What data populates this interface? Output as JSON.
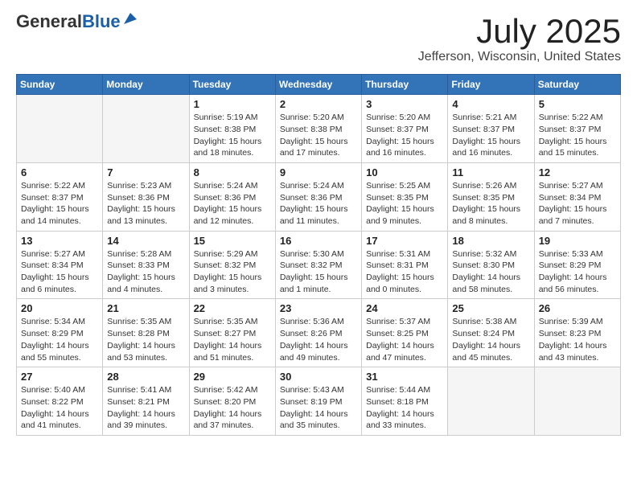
{
  "header": {
    "logo_general": "General",
    "logo_blue": "Blue",
    "title": "July 2025",
    "subtitle": "Jefferson, Wisconsin, United States"
  },
  "weekdays": [
    "Sunday",
    "Monday",
    "Tuesday",
    "Wednesday",
    "Thursday",
    "Friday",
    "Saturday"
  ],
  "weeks": [
    [
      {
        "day": "",
        "info": ""
      },
      {
        "day": "",
        "info": ""
      },
      {
        "day": "1",
        "info": "Sunrise: 5:19 AM\nSunset: 8:38 PM\nDaylight: 15 hours and 18 minutes."
      },
      {
        "day": "2",
        "info": "Sunrise: 5:20 AM\nSunset: 8:38 PM\nDaylight: 15 hours and 17 minutes."
      },
      {
        "day": "3",
        "info": "Sunrise: 5:20 AM\nSunset: 8:37 PM\nDaylight: 15 hours and 16 minutes."
      },
      {
        "day": "4",
        "info": "Sunrise: 5:21 AM\nSunset: 8:37 PM\nDaylight: 15 hours and 16 minutes."
      },
      {
        "day": "5",
        "info": "Sunrise: 5:22 AM\nSunset: 8:37 PM\nDaylight: 15 hours and 15 minutes."
      }
    ],
    [
      {
        "day": "6",
        "info": "Sunrise: 5:22 AM\nSunset: 8:37 PM\nDaylight: 15 hours and 14 minutes."
      },
      {
        "day": "7",
        "info": "Sunrise: 5:23 AM\nSunset: 8:36 PM\nDaylight: 15 hours and 13 minutes."
      },
      {
        "day": "8",
        "info": "Sunrise: 5:24 AM\nSunset: 8:36 PM\nDaylight: 15 hours and 12 minutes."
      },
      {
        "day": "9",
        "info": "Sunrise: 5:24 AM\nSunset: 8:36 PM\nDaylight: 15 hours and 11 minutes."
      },
      {
        "day": "10",
        "info": "Sunrise: 5:25 AM\nSunset: 8:35 PM\nDaylight: 15 hours and 9 minutes."
      },
      {
        "day": "11",
        "info": "Sunrise: 5:26 AM\nSunset: 8:35 PM\nDaylight: 15 hours and 8 minutes."
      },
      {
        "day": "12",
        "info": "Sunrise: 5:27 AM\nSunset: 8:34 PM\nDaylight: 15 hours and 7 minutes."
      }
    ],
    [
      {
        "day": "13",
        "info": "Sunrise: 5:27 AM\nSunset: 8:34 PM\nDaylight: 15 hours and 6 minutes."
      },
      {
        "day": "14",
        "info": "Sunrise: 5:28 AM\nSunset: 8:33 PM\nDaylight: 15 hours and 4 minutes."
      },
      {
        "day": "15",
        "info": "Sunrise: 5:29 AM\nSunset: 8:32 PM\nDaylight: 15 hours and 3 minutes."
      },
      {
        "day": "16",
        "info": "Sunrise: 5:30 AM\nSunset: 8:32 PM\nDaylight: 15 hours and 1 minute."
      },
      {
        "day": "17",
        "info": "Sunrise: 5:31 AM\nSunset: 8:31 PM\nDaylight: 15 hours and 0 minutes."
      },
      {
        "day": "18",
        "info": "Sunrise: 5:32 AM\nSunset: 8:30 PM\nDaylight: 14 hours and 58 minutes."
      },
      {
        "day": "19",
        "info": "Sunrise: 5:33 AM\nSunset: 8:29 PM\nDaylight: 14 hours and 56 minutes."
      }
    ],
    [
      {
        "day": "20",
        "info": "Sunrise: 5:34 AM\nSunset: 8:29 PM\nDaylight: 14 hours and 55 minutes."
      },
      {
        "day": "21",
        "info": "Sunrise: 5:35 AM\nSunset: 8:28 PM\nDaylight: 14 hours and 53 minutes."
      },
      {
        "day": "22",
        "info": "Sunrise: 5:35 AM\nSunset: 8:27 PM\nDaylight: 14 hours and 51 minutes."
      },
      {
        "day": "23",
        "info": "Sunrise: 5:36 AM\nSunset: 8:26 PM\nDaylight: 14 hours and 49 minutes."
      },
      {
        "day": "24",
        "info": "Sunrise: 5:37 AM\nSunset: 8:25 PM\nDaylight: 14 hours and 47 minutes."
      },
      {
        "day": "25",
        "info": "Sunrise: 5:38 AM\nSunset: 8:24 PM\nDaylight: 14 hours and 45 minutes."
      },
      {
        "day": "26",
        "info": "Sunrise: 5:39 AM\nSunset: 8:23 PM\nDaylight: 14 hours and 43 minutes."
      }
    ],
    [
      {
        "day": "27",
        "info": "Sunrise: 5:40 AM\nSunset: 8:22 PM\nDaylight: 14 hours and 41 minutes."
      },
      {
        "day": "28",
        "info": "Sunrise: 5:41 AM\nSunset: 8:21 PM\nDaylight: 14 hours and 39 minutes."
      },
      {
        "day": "29",
        "info": "Sunrise: 5:42 AM\nSunset: 8:20 PM\nDaylight: 14 hours and 37 minutes."
      },
      {
        "day": "30",
        "info": "Sunrise: 5:43 AM\nSunset: 8:19 PM\nDaylight: 14 hours and 35 minutes."
      },
      {
        "day": "31",
        "info": "Sunrise: 5:44 AM\nSunset: 8:18 PM\nDaylight: 14 hours and 33 minutes."
      },
      {
        "day": "",
        "info": ""
      },
      {
        "day": "",
        "info": ""
      }
    ]
  ]
}
